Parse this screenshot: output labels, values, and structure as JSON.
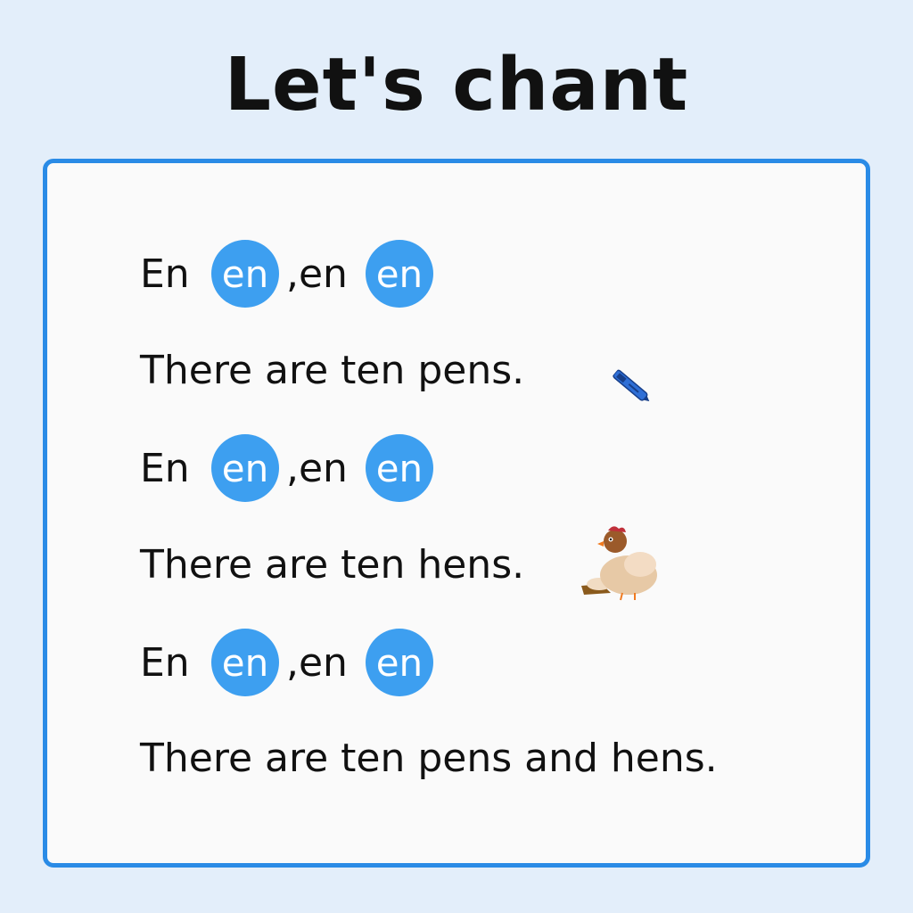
{
  "title": "Let's chant",
  "lines": [
    {
      "type": "chant",
      "word1": "En",
      "bubble1": "en",
      "word2": ",en",
      "bubble2": "en"
    },
    {
      "type": "sentence",
      "text": "There are ten pens.",
      "icon": "pen-icon"
    },
    {
      "type": "chant",
      "word1": "En",
      "bubble1": "en",
      "word2": ",en",
      "bubble2": "en"
    },
    {
      "type": "sentence",
      "text": "There are ten hens.",
      "icon": "hen-icon"
    },
    {
      "type": "chant",
      "word1": "En",
      "bubble1": "en",
      "word2": ",en",
      "bubble2": "en"
    },
    {
      "type": "sentence",
      "text": "There are ten pens and hens."
    }
  ],
  "colors": {
    "accent": "#3d9ff0",
    "border": "#2a8be6",
    "background": "#e3eefa"
  }
}
